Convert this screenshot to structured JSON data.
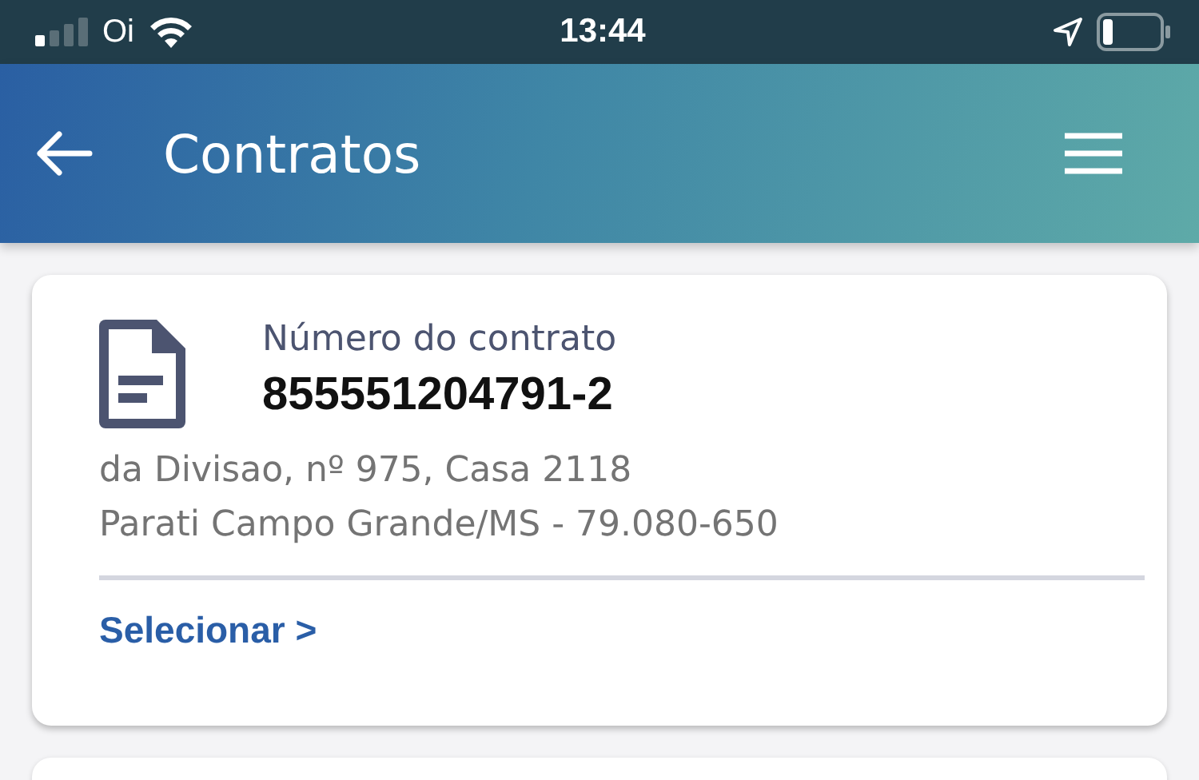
{
  "status_bar": {
    "carrier": "Oi",
    "time": "13:44"
  },
  "header": {
    "title": "Contratos"
  },
  "contracts": [
    {
      "label": "Número do contrato",
      "number": "855551204791-2",
      "address_lines": [
        "da Divisao, nº 975, Casa 2118",
        "Parati Campo Grande/MS - 79.080-650"
      ],
      "action": "Selecionar >"
    }
  ]
}
